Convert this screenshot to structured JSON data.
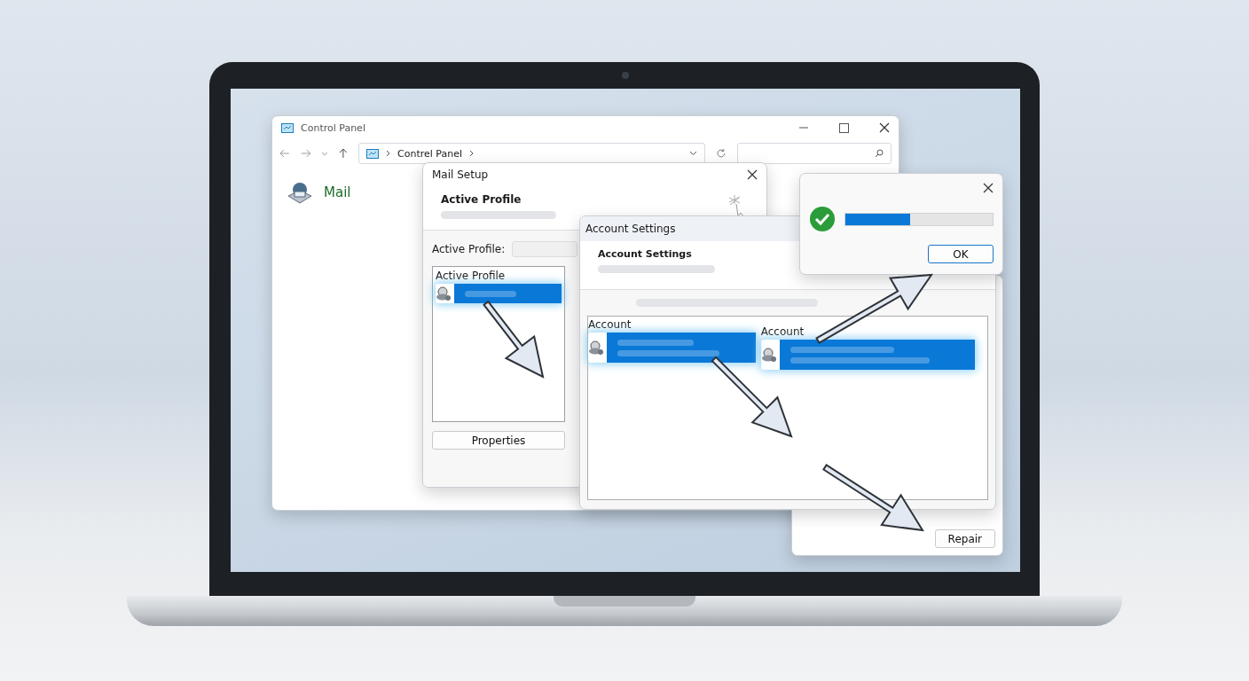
{
  "control_panel": {
    "title": "Control Panel",
    "breadcrumb": "Contrel Panel",
    "items": [
      {
        "label": "Mail"
      }
    ]
  },
  "mail_setup": {
    "title": "Mail Setup",
    "header": "Active Profile",
    "field_label": "Active Profile:",
    "list": {
      "header": "Active Profile",
      "rows": [
        {
          "selected": true
        }
      ]
    },
    "button": "Properties"
  },
  "account_settings": {
    "title": "Account Settings",
    "header": "Account Settings",
    "columns": [
      {
        "header": "Account",
        "rows": [
          {
            "selected": true
          }
        ]
      },
      {
        "header": "Account",
        "rows": [
          {
            "selected": true
          }
        ]
      }
    ]
  },
  "repair_window": {
    "button": "Repair"
  },
  "progress_dialog": {
    "level": 0.44,
    "button": {
      "label": "OK",
      "default": true
    }
  }
}
